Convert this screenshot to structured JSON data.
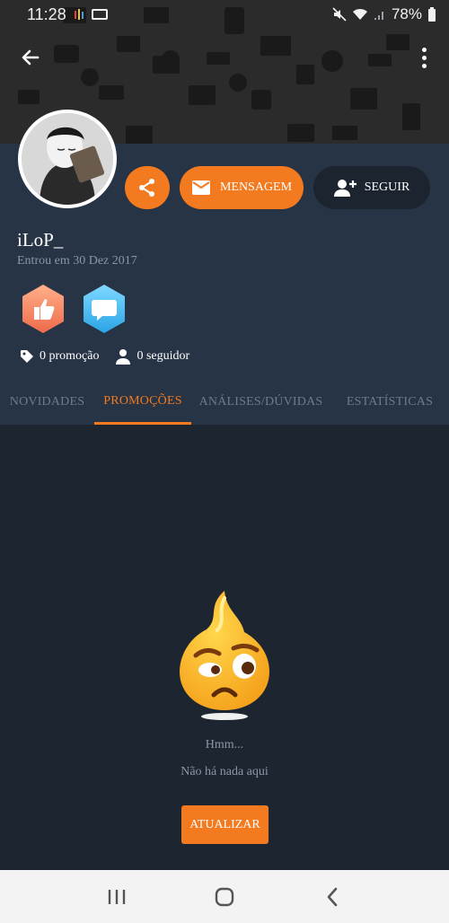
{
  "statusbar": {
    "time": "11:28",
    "battery": "78%"
  },
  "profile": {
    "username": "iLoP_",
    "joined": "Entrou em 30 Dez 2017",
    "message_label": "MENSAGEM",
    "follow_label": "SEGUIR",
    "promotions_stat": "0 promoção",
    "followers_stat": "0 seguidor"
  },
  "tabs": [
    {
      "label": "NOVIDADES"
    },
    {
      "label": "PROMOÇÕES"
    },
    {
      "label": "ANÁLISES/DÚVIDAS"
    },
    {
      "label": "ESTATÍSTICAS"
    }
  ],
  "content": {
    "hmm": "Hmm...",
    "empty": "Não há nada aqui",
    "refresh_label": "ATUALIZAR"
  },
  "colors": {
    "accent": "#f47a1f",
    "profile_bg": "#273445",
    "page_bg": "#1d2531"
  }
}
